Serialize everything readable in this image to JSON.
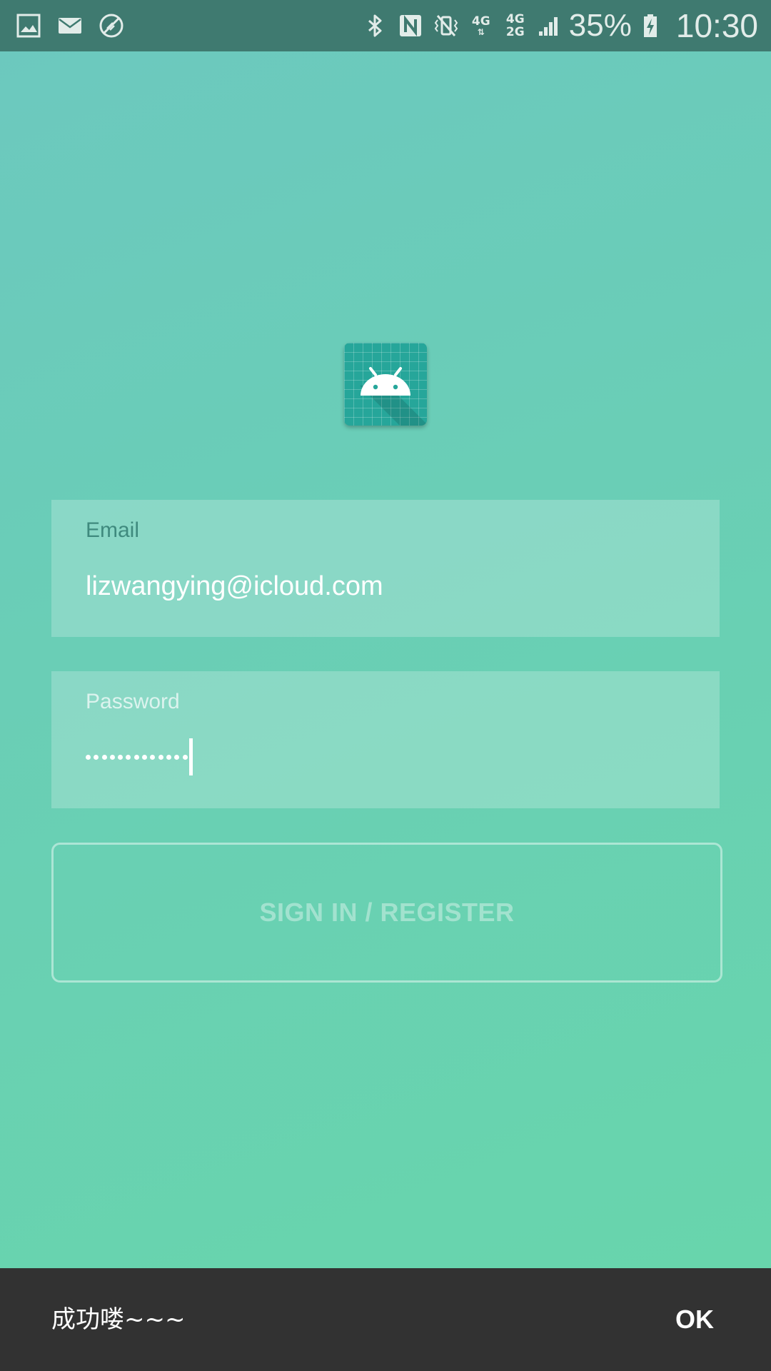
{
  "status_bar": {
    "left_icons": [
      "gallery-icon",
      "mail-icon",
      "no-data-icon"
    ],
    "right_icons": [
      "bluetooth-icon",
      "nfc-icon",
      "vibrate-icon"
    ],
    "network_1": "4G",
    "network_2_top": "4G",
    "network_2_bottom": "2G",
    "battery_percent": "35%",
    "time": "10:30"
  },
  "login": {
    "email_label": "Email",
    "email_value": "lizwangying@icloud.com",
    "password_label": "Password",
    "password_dot_count": 13,
    "sign_in_label": "SIGN IN / REGISTER"
  },
  "snackbar": {
    "message": "成功喽~~~",
    "action": "OK"
  },
  "colors": {
    "status_bar": "#3f7a70",
    "background_top": "#6cc8bf",
    "background_bottom": "#68d6ab",
    "app_icon": "#26a69a",
    "snackbar": "#323232"
  }
}
